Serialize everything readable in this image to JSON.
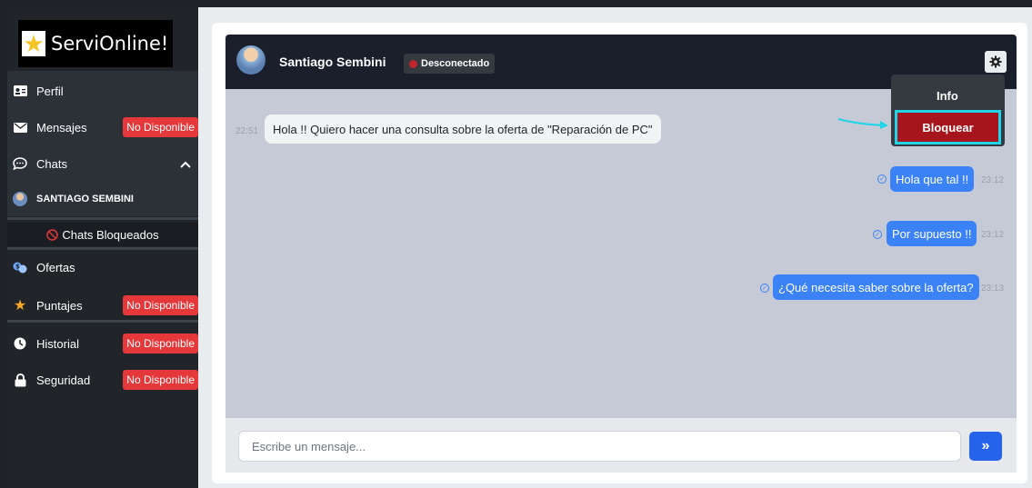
{
  "brand": {
    "name": "ServiOnline!",
    "icon": "star-icon"
  },
  "sidebar": {
    "items": [
      {
        "label": "Perfil",
        "icon": "id-card-icon"
      },
      {
        "label": "Mensajes",
        "icon": "envelope-icon",
        "badge": "No Disponible"
      },
      {
        "label": "Chats",
        "icon": "chat-bubble-icon"
      },
      {
        "label": "SANTIAGO SEMBINI",
        "icon": "avatar"
      },
      {
        "label": "Chats Bloqueados",
        "icon": "ban-icon"
      },
      {
        "label": "Ofertas",
        "icon": "money-icon"
      },
      {
        "label": "Puntajes",
        "icon": "star-icon",
        "badge": "No Disponible"
      },
      {
        "label": "Historial",
        "icon": "clock-icon",
        "badge": "No Disponible"
      },
      {
        "label": "Seguridad",
        "icon": "lock-icon",
        "badge": "No Disponible"
      }
    ]
  },
  "chat": {
    "contact_name": "Santiago Sembini",
    "status": "Desconectado",
    "messages": [
      {
        "direction": "in",
        "text": "Hola !! Quiero hacer una consulta sobre la oferta de \"Reparación de PC\"",
        "time": "22:51"
      },
      {
        "direction": "out",
        "text": "Hola que tal !!",
        "time": "23:12"
      },
      {
        "direction": "out",
        "text": "Por supuesto !!",
        "time": "23:12"
      },
      {
        "direction": "out",
        "text": "¿Qué necesita saber sobre la oferta?",
        "time": "23:13"
      }
    ],
    "menu": {
      "info": "Info",
      "block": "Bloquear"
    },
    "input_placeholder": "Escribe un mensaje...",
    "send_label": "»"
  },
  "colors": {
    "accent": "#3b82f6",
    "danger": "#a5151b",
    "highlight": "#1fd3e8",
    "badge": "#e5383b"
  }
}
